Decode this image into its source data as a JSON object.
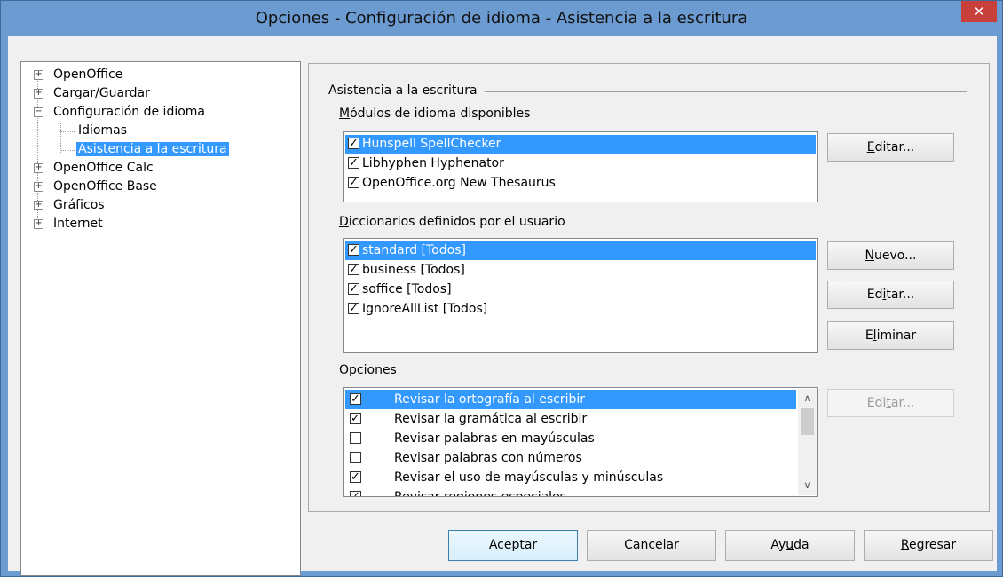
{
  "window": {
    "title": "Opciones - Configuración de idioma - Asistencia a la escritura",
    "close_glyph": "✕"
  },
  "tree": {
    "items": [
      {
        "label": "OpenOffice",
        "expander": "+"
      },
      {
        "label": "Cargar/Guardar",
        "expander": "+"
      },
      {
        "label": "Configuración de idioma",
        "expander": "−"
      },
      {
        "label": "Idiomas"
      },
      {
        "label": "Asistencia a la escritura",
        "selected": true
      },
      {
        "label": "OpenOffice Calc",
        "expander": "+"
      },
      {
        "label": "OpenOffice Base",
        "expander": "+"
      },
      {
        "label": "Gráficos",
        "expander": "+"
      },
      {
        "label": "Internet",
        "expander": "+"
      }
    ]
  },
  "panel": {
    "group_title": "Asistencia a la escritura",
    "modules": {
      "label_pre": "",
      "label_acc": "M",
      "label_post": "ódulos de idioma disponibles",
      "items": [
        {
          "label": "Hunspell SpellChecker",
          "checked": true,
          "selected": true
        },
        {
          "label": "Libhyphen Hyphenator",
          "checked": true
        },
        {
          "label": "OpenOffice.org New Thesaurus",
          "checked": true
        }
      ],
      "edit_pre": "",
      "edit_acc": "E",
      "edit_post": "ditar..."
    },
    "dictionaries": {
      "label_pre": "",
      "label_acc": "D",
      "label_post": "iccionarios definidos por el usuario",
      "items": [
        {
          "label": "standard [Todos]",
          "checked": true,
          "selected": true
        },
        {
          "label": "business [Todos]",
          "checked": true
        },
        {
          "label": "soffice [Todos]",
          "checked": true
        },
        {
          "label": "IgnoreAllList [Todos]",
          "checked": true
        }
      ],
      "new_pre": "",
      "new_acc": "N",
      "new_post": "uevo...",
      "edit_pre": "Ed",
      "edit_acc": "i",
      "edit_post": "tar...",
      "delete_pre": "E",
      "delete_acc": "l",
      "delete_post": "iminar"
    },
    "options": {
      "label_pre": "",
      "label_acc": "O",
      "label_post": "pciones",
      "items": [
        {
          "label": "Revisar la ortografía al escribir",
          "checked": true,
          "selected": true
        },
        {
          "label": "Revisar la gramática al escribir",
          "checked": true
        },
        {
          "label": "Revisar palabras en mayúsculas",
          "checked": false
        },
        {
          "label": "Revisar palabras con números",
          "checked": false
        },
        {
          "label": "Revisar el uso de mayúsculas y minúsculas",
          "checked": true
        },
        {
          "label": "Revisar regiones especiales",
          "checked": true
        }
      ],
      "edit_pre": "Edi",
      "edit_acc": "t",
      "edit_post": "ar...",
      "scroll_up": "∧",
      "scroll_down": "∨"
    }
  },
  "footer": {
    "ok": "Aceptar",
    "cancel": "Cancelar",
    "help_pre": "Ay",
    "help_acc": "u",
    "help_post": "da",
    "reset_pre": "",
    "reset_acc": "R",
    "reset_post": "egresar"
  },
  "colors": {
    "titlebar": "#6b9bd0",
    "selection": "#3399ff",
    "close": "#c7403a"
  }
}
